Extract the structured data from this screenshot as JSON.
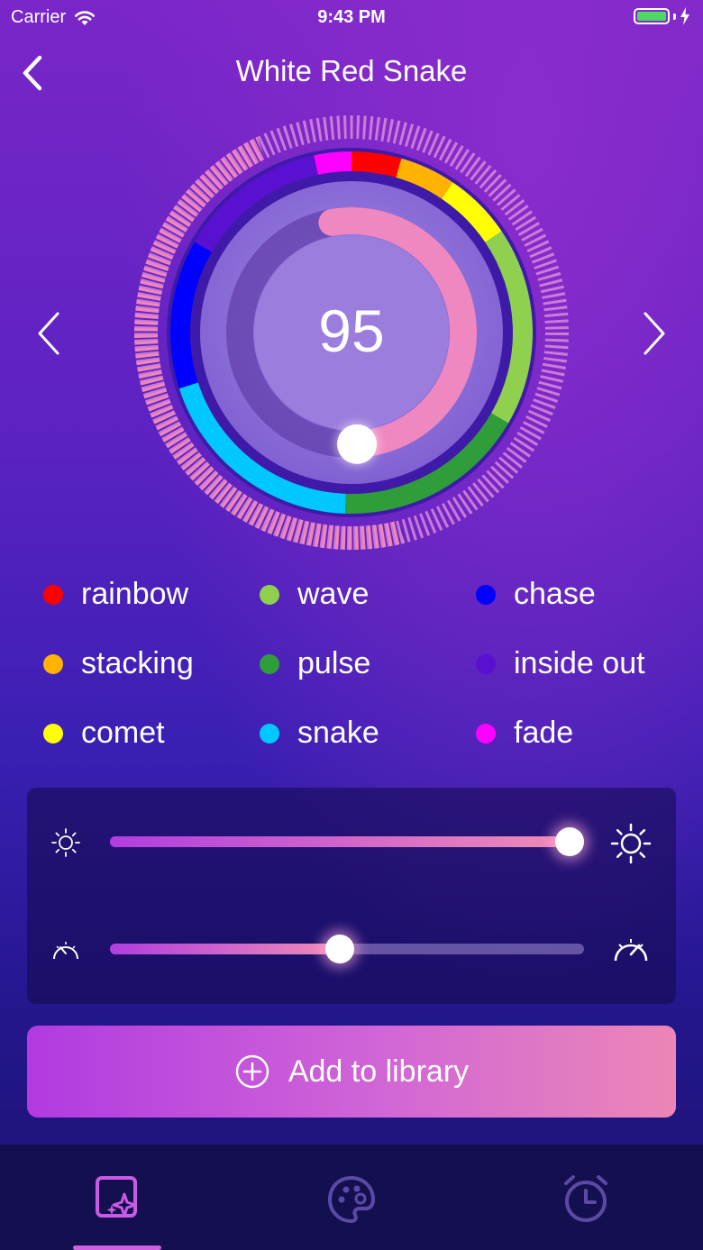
{
  "status_bar": {
    "carrier": "Carrier",
    "time": "9:43 PM"
  },
  "header": {
    "title": "White Red Snake"
  },
  "dial": {
    "value": "95",
    "progress_fraction": 0.52
  },
  "legend": [
    {
      "label": "rainbow",
      "color": "#ff0000"
    },
    {
      "label": "wave",
      "color": "#8fd14f"
    },
    {
      "label": "chase",
      "color": "#0000ff"
    },
    {
      "label": "stacking",
      "color": "#ffb300"
    },
    {
      "label": "pulse",
      "color": "#2e9d3a"
    },
    {
      "label": "inside out",
      "color": "#5a10d0"
    },
    {
      "label": "comet",
      "color": "#ffff00"
    },
    {
      "label": "snake",
      "color": "#00c8ff"
    },
    {
      "label": "fade",
      "color": "#ff00ff"
    }
  ],
  "sliders": {
    "brightness": {
      "icon_min": "sun-small-icon",
      "icon_max": "sun-large-icon",
      "level": 1.0
    },
    "speed": {
      "icon_min": "speedometer-slow-icon",
      "icon_max": "speedometer-fast-icon",
      "level": 0.5
    }
  },
  "actions": {
    "add_label": "Add to library"
  },
  "tabs": [
    {
      "icon": "effects-icon",
      "active": true
    },
    {
      "icon": "palette-icon",
      "active": false
    },
    {
      "icon": "alarm-clock-icon",
      "active": false
    }
  ]
}
